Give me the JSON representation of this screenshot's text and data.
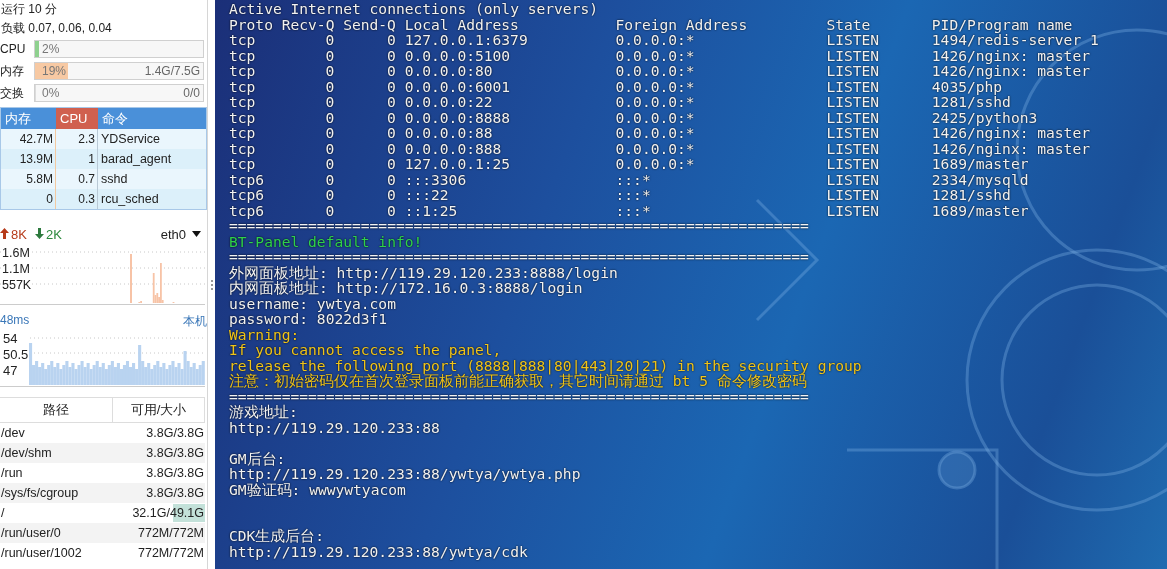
{
  "sidebar": {
    "uptime": "运行 10 分",
    "load": "负载 0.07, 0.06, 0.04",
    "meters": [
      {
        "label": "CPU",
        "reading": "2%",
        "level": 0.02,
        "color": "#8fd18f"
      },
      {
        "label": "内存",
        "reading": "19%",
        "detail": "1.4G/7.5G",
        "level": 0.19,
        "color": "#f7c9a3"
      },
      {
        "label": "交换",
        "reading": "0%",
        "detail": "0/0",
        "level": 0
      }
    ],
    "process_table": {
      "columns": [
        {
          "label": "内存",
          "sorted": false
        },
        {
          "label": "CPU",
          "sorted": true
        },
        {
          "label": "命令",
          "sorted": false
        }
      ],
      "rows": [
        [
          "42.7M",
          "2.3",
          "YDService"
        ],
        [
          "13.9M",
          "1",
          "barad_agent"
        ],
        [
          "5.8M",
          "0.7",
          "sshd"
        ],
        [
          "0",
          "0.3",
          "rcu_sched"
        ]
      ]
    },
    "network": {
      "upload": "8K",
      "download": "2K",
      "interface": "eth0",
      "y_labels": [
        "1.6M",
        "1.1M",
        "557K"
      ]
    },
    "ping": {
      "latency": "48ms",
      "target": "本机",
      "y_labels": [
        "54",
        "50.5",
        "47"
      ]
    },
    "disk_table": {
      "columns": [
        "路径",
        "可用/大小"
      ],
      "rows": [
        {
          "path": "/dev",
          "usage": "3.8G/3.8G",
          "level": 0
        },
        {
          "path": "/dev/shm",
          "usage": "3.8G/3.8G",
          "level": 0
        },
        {
          "path": "/run",
          "usage": "3.8G/3.8G",
          "level": 0
        },
        {
          "path": "/sys/fs/cgroup",
          "usage": "3.8G/3.8G",
          "level": 0
        },
        {
          "path": "/",
          "usage": "32.1G/49.1G",
          "level": 0.35
        },
        {
          "path": "/run/user/0",
          "usage": "772M/772M",
          "level": 0
        },
        {
          "path": "/run/user/1002",
          "usage": "772M/772M",
          "level": 0
        }
      ]
    }
  },
  "terminal": {
    "intro": "Active Internet connections (only servers)",
    "netstat": {
      "columns": [
        "Proto",
        "Recv-Q",
        "Send-Q",
        "Local Address",
        "Foreign Address",
        "State",
        "PID/Program name"
      ],
      "rows": [
        [
          "tcp",
          "0",
          "0",
          "127.0.0.1:6379",
          "0.0.0.0:*",
          "LISTEN",
          "1494/redis-server 1"
        ],
        [
          "tcp",
          "0",
          "0",
          "0.0.0.0:5100",
          "0.0.0.0:*",
          "LISTEN",
          "1426/nginx: master"
        ],
        [
          "tcp",
          "0",
          "0",
          "0.0.0.0:80",
          "0.0.0.0:*",
          "LISTEN",
          "1426/nginx: master"
        ],
        [
          "tcp",
          "0",
          "0",
          "0.0.0.0:6001",
          "0.0.0.0:*",
          "LISTEN",
          "4035/php"
        ],
        [
          "tcp",
          "0",
          "0",
          "0.0.0.0:22",
          "0.0.0.0:*",
          "LISTEN",
          "1281/sshd"
        ],
        [
          "tcp",
          "0",
          "0",
          "0.0.0.0:8888",
          "0.0.0.0:*",
          "LISTEN",
          "2425/python3"
        ],
        [
          "tcp",
          "0",
          "0",
          "0.0.0.0:88",
          "0.0.0.0:*",
          "LISTEN",
          "1426/nginx: master"
        ],
        [
          "tcp",
          "0",
          "0",
          "0.0.0.0:888",
          "0.0.0.0:*",
          "LISTEN",
          "1426/nginx: master"
        ],
        [
          "tcp",
          "0",
          "0",
          "127.0.0.1:25",
          "0.0.0.0:*",
          "LISTEN",
          "1689/master"
        ],
        [
          "tcp6",
          "0",
          "0",
          ":::3306",
          ":::*",
          "LISTEN",
          "2334/mysqld"
        ],
        [
          "tcp6",
          "0",
          "0",
          ":::22",
          ":::*",
          "LISTEN",
          "1281/sshd"
        ],
        [
          "tcp6",
          "0",
          "0",
          "::1:25",
          ":::*",
          "LISTEN",
          "1689/master"
        ]
      ]
    },
    "lines": [
      {
        "kind": "rule",
        "text": "=================================================================="
      },
      {
        "kind": "heading",
        "text": "BT-Panel default info!"
      },
      {
        "kind": "rule",
        "text": "=================================================================="
      },
      {
        "kind": "text",
        "text": "外网面板地址: http://119.29.120.233:8888/login"
      },
      {
        "kind": "text",
        "text": "内网面板地址: http://172.16.0.3:8888/login"
      },
      {
        "kind": "text",
        "text": "username: ywtya.com"
      },
      {
        "kind": "text",
        "text": "password: 8022d3f1"
      },
      {
        "kind": "warning",
        "text": "Warning:"
      },
      {
        "kind": "warning",
        "text": "If you cannot access the panel,"
      },
      {
        "kind": "warning",
        "text": "release the following port (8888|888|80|443|20|21) in the security group"
      },
      {
        "kind": "warning",
        "text": "注意：初始密码仅在首次登录面板前能正确获取，其它时间请通过 bt 5 命令修改密码"
      },
      {
        "kind": "rule",
        "text": "=================================================================="
      },
      {
        "kind": "text",
        "text": "游戏地址:"
      },
      {
        "kind": "text",
        "text": "http://119.29.120.233:88"
      },
      {
        "kind": "blank"
      },
      {
        "kind": "text",
        "text": "GM后台:"
      },
      {
        "kind": "text",
        "text": "http://119.29.120.233:88/ywtya/ywtya.php"
      },
      {
        "kind": "text",
        "text": "GM验证码: wwwywtyacom"
      },
      {
        "kind": "blank"
      },
      {
        "kind": "blank"
      },
      {
        "kind": "text",
        "text": "CDK生成后台:"
      },
      {
        "kind": "text",
        "text": "http://119.29.120.233:88/ywtya/cdk"
      }
    ]
  }
}
